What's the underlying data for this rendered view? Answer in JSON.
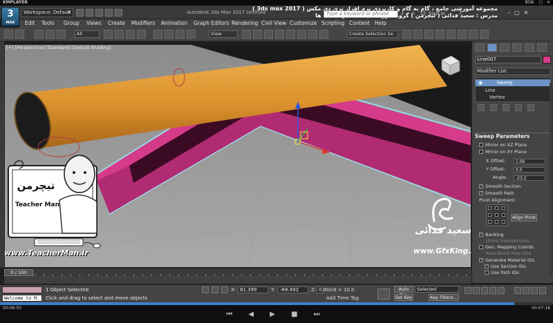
{
  "player": {
    "name": "KMPLAYER",
    "right_label": "BOX",
    "time_elapsed": "00:06:50",
    "time_total": "00:07:18",
    "progress": 0.93
  },
  "title_bar": {
    "workspace_label": "Workspace: Default",
    "app_title": "Autodesk 3ds Max 2017    Untitled",
    "persian_title": "مجموعه آموزشی جامع ، گام به گام و کاربردی نرم افزار تری دی مکس ( 3ds max 2017 )   مدرس : سعید فدائی ( تیچرمن ) گروه آموزشی پادشاه گرافیست ها",
    "search_placeholder": "Type a keyword or phrase",
    "sign_in": "Sign In"
  },
  "menu": [
    "Edit",
    "Tools",
    "Group",
    "Views",
    "Create",
    "Modifiers",
    "Animation",
    "Graph Editors",
    "Rendering",
    "Civil View",
    "Customize",
    "Scripting",
    "Content",
    "Help"
  ],
  "toolbar": {
    "filter": "All",
    "ref_coord": "View",
    "selection_set": "Create Selection Se"
  },
  "viewport": {
    "label": "[+] [Perspective] [Standard] [Default Shading]"
  },
  "command_panel": {
    "object_name": "Line007",
    "modifier_list": "Modifier List",
    "stack": [
      "Sweep",
      "Line",
      "Vertex"
    ],
    "rollout_title": "Sweep Parameters",
    "mirror_xz": "Mirror on XZ Plane",
    "mirror_xy": "Mirror on XY Plane",
    "x_offset_label": "X Offset:",
    "x_offset": "1.06",
    "y_offset_label": "Y Offset:",
    "y_offset": "0.0",
    "angle_label": "Angle:",
    "angle": "-23.2",
    "smooth_section": "Smooth Section",
    "smooth_path": "Smooth Path",
    "pivot_alignment": "Pivot Alignment:",
    "align_pivot": "Align Pivot",
    "banking": "Banking",
    "union_intersections": "Union Intersections",
    "gen_mapping": "Gen. Mapping Coords.",
    "real_world": "Real-World Map Size",
    "gen_material_ids": "Generate Material IDs",
    "use_section_ids": "Use Section IDs",
    "use_path_ids": "Use Path IDs"
  },
  "time_slider": {
    "label": "0 / 100"
  },
  "status": {
    "welcome": "Welcome to M.",
    "selected": "1 Object Selected",
    "prompt": "Click and drag to select and move objects",
    "x": "81.399",
    "y": "-68.492",
    "z": "0.0",
    "grid": "Grid = 10.0",
    "add_time_tag": "Add Time Tag",
    "auto_key": "Auto Key",
    "selected_drop": "Selected",
    "set_key": "Set Key",
    "key_filters": "Key Filters..."
  },
  "watermark": {
    "teacher_name": "Teacher Man",
    "teacher_persian": "تیچرمن",
    "teacher_url": "www.TeacherMan.ir",
    "gfx_name": "سعید فدائی",
    "gfx_url": "www.GfxKing.ir"
  },
  "colors": {
    "tube": "#e39c3a",
    "sweep": "#d63a8a",
    "selection_highlight": "#6b93c5"
  }
}
